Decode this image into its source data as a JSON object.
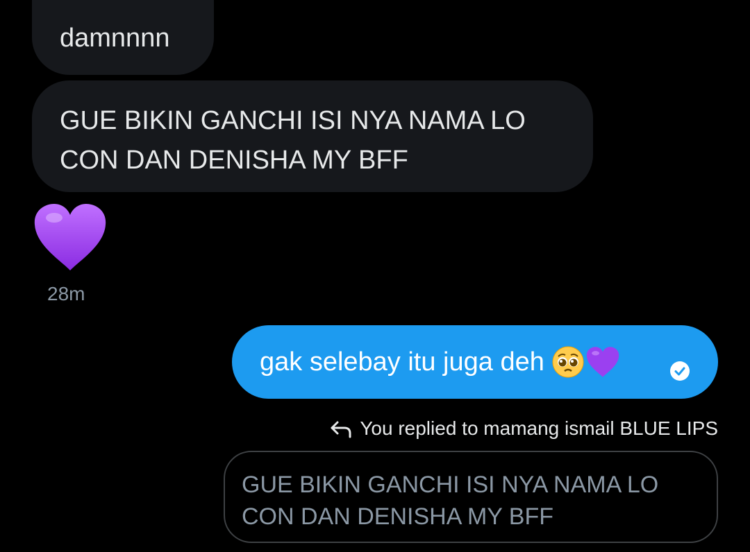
{
  "conversation": {
    "incoming": [
      {
        "text": "damnnnn"
      },
      {
        "text_line1": "GUE BIKIN GANCHI ISI NYA NAMA LO",
        "text_line2": "CON DAN DENISHA MY BFF"
      }
    ],
    "incoming_emoji": "purple-heart",
    "incoming_time": "28m",
    "outgoing": {
      "text": "gak selebay itu juga deh",
      "emojis": [
        "pleading-face",
        "purple-heart"
      ],
      "status_icon": "seen-check-icon"
    },
    "reply_context": {
      "label": "You replied to mamang ismail BLUE LIPS",
      "icon": "reply-arrow-icon",
      "quoted_line1": "GUE BIKIN GANCHI ISI NYA NAMA LO",
      "quoted_line2": "CON DAN DENISHA MY BFF"
    }
  },
  "colors": {
    "background": "#000000",
    "incoming_bubble": "#16181c",
    "outgoing_bubble": "#1d9bf0",
    "heart": "#9b40f0",
    "muted_text": "#8b98a5"
  }
}
